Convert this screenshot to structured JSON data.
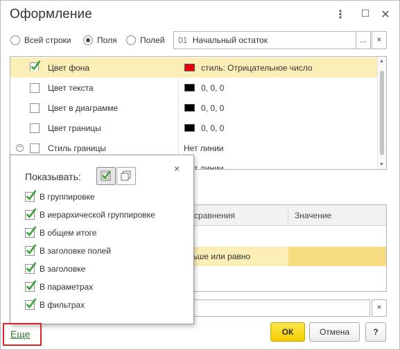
{
  "window": {
    "title": "Оформление",
    "controls": {
      "more": "⋮",
      "maximize": "☐",
      "close": "✕"
    }
  },
  "scope_radio": {
    "options": [
      {
        "label": "Всей строки",
        "selected": false
      },
      {
        "label": "Поля",
        "selected": true
      },
      {
        "label": "Полей",
        "selected": false
      }
    ],
    "field": {
      "code": "01",
      "value": "Начальный остаток"
    },
    "select_btn": "...",
    "clear_btn": "×"
  },
  "appearance_grid": {
    "rows": [
      {
        "name": "Цвет фона",
        "checked": true,
        "selected": true,
        "swatch": "#e8000b",
        "value": "стиль: Отрицательное число"
      },
      {
        "name": "Цвет текста",
        "checked": false,
        "selected": false,
        "swatch": "#000000",
        "value": "0, 0, 0"
      },
      {
        "name": "Цвет в диаграмме",
        "checked": false,
        "selected": false,
        "swatch": "#000000",
        "value": "0, 0, 0"
      },
      {
        "name": "Цвет границы",
        "checked": false,
        "selected": false,
        "swatch": "#000000",
        "value": "0, 0, 0"
      },
      {
        "name": "Стиль границы",
        "checked": false,
        "selected": false,
        "collapsible": true,
        "value": "Нет линии"
      },
      {
        "name": "",
        "checked": false,
        "selected": false,
        "value": "Нет линии"
      }
    ]
  },
  "condition_table": {
    "col_compare": "Вид сравнения",
    "col_value": "Значение",
    "row_compare": "Меньше или равно"
  },
  "bottom_field": {
    "clear_btn": "×"
  },
  "popup": {
    "title": "Показывать:",
    "close": "×",
    "items": [
      {
        "label": "В группировке",
        "checked": true
      },
      {
        "label": "В иерархической группировке",
        "checked": true
      },
      {
        "label": "В общем итоге",
        "checked": true
      },
      {
        "label": "В заголовке полей",
        "checked": true
      },
      {
        "label": "В заголовке",
        "checked": true
      },
      {
        "label": "В параметрах",
        "checked": true
      },
      {
        "label": "В фильтрах",
        "checked": true
      }
    ]
  },
  "footer": {
    "more_link": "Еще",
    "ok": "ОК",
    "cancel": "Отмена",
    "help": "?"
  },
  "colors": {
    "selection_row": "#fbeeb6",
    "checkmark": "#3aa03a",
    "ok_button": "#f5d300",
    "highlight_frame": "#d9252a",
    "link": "#2c7a35"
  }
}
